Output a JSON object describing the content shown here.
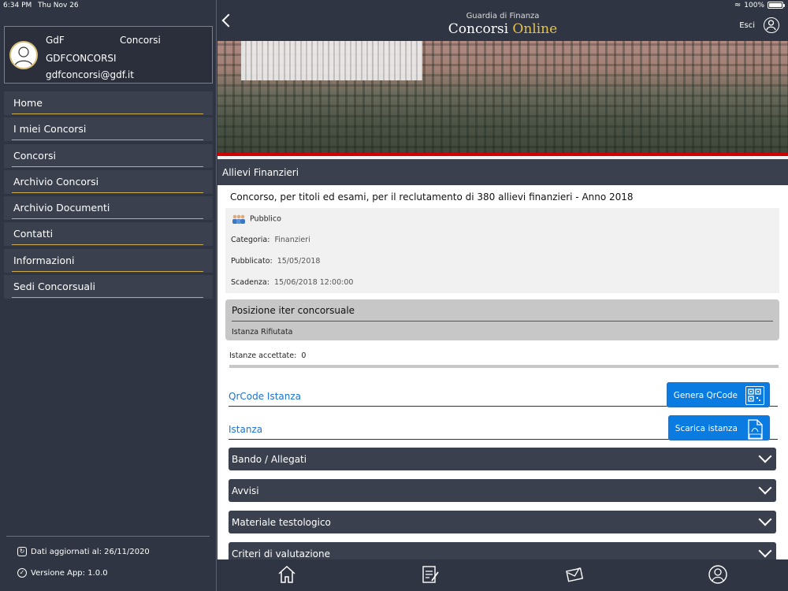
{
  "status_bar": {
    "time": "6:34 PM",
    "date": "Thu Nov 26",
    "battery": "100%",
    "battery_level": 1.0
  },
  "profile": {
    "name_first": "GdF",
    "name_second": "Concorsi",
    "username": "GDFCONCORSI",
    "email": "gdfconcorsi@gdf.it"
  },
  "menu": [
    {
      "label": "Home"
    },
    {
      "label": "I miei Concorsi"
    },
    {
      "label": "Concorsi"
    },
    {
      "label": "Archivio Concorsi"
    },
    {
      "label": "Archivio Documenti"
    },
    {
      "label": "Contatti"
    },
    {
      "label": "Informazioni"
    },
    {
      "label": "Sedi Concorsuali"
    }
  ],
  "footer": {
    "updated": "Dati aggiornati al: 26/11/2020",
    "version": "Versione App: 1.0.0"
  },
  "header": {
    "brand_top": "Guardia di Finanza",
    "brand_main": "Concorsi",
    "brand_o": "O",
    "brand_rest": "nline",
    "logout": "Esci"
  },
  "section": {
    "title": "Allievi Finanzieri"
  },
  "concorso": {
    "title": "Concorso, per titoli ed esami, per il reclutamento di 380 allievi finanzieri - Anno 2018",
    "visibility": "Pubblico",
    "categoria_label": "Categoria:",
    "categoria_value": "Finanzieri",
    "pubblicato_label": "Pubblicato:",
    "pubblicato_value": "15/05/2018",
    "scadenza_label": "Scadenza:",
    "scadenza_value": "15/06/2018 12:00:00"
  },
  "iter": {
    "title": "Posizione iter concorsuale",
    "status": "Istanza Rifiutata"
  },
  "accettate": {
    "label": "Istanze accettate:",
    "value": "0"
  },
  "actions": {
    "qrcode_label": "QrCode Istanza",
    "qrcode_button": "Genera QrCode",
    "istanza_label": "Istanza",
    "istanza_button": "Scarica istanza"
  },
  "accordions": [
    {
      "label": "Bando / Allegati"
    },
    {
      "label": "Avvisi"
    },
    {
      "label": "Materiale testologico"
    },
    {
      "label": "Criteri di valutazione"
    }
  ],
  "tabbar": [
    "home-icon",
    "document-edit-icon",
    "mail-icon",
    "user-icon"
  ]
}
